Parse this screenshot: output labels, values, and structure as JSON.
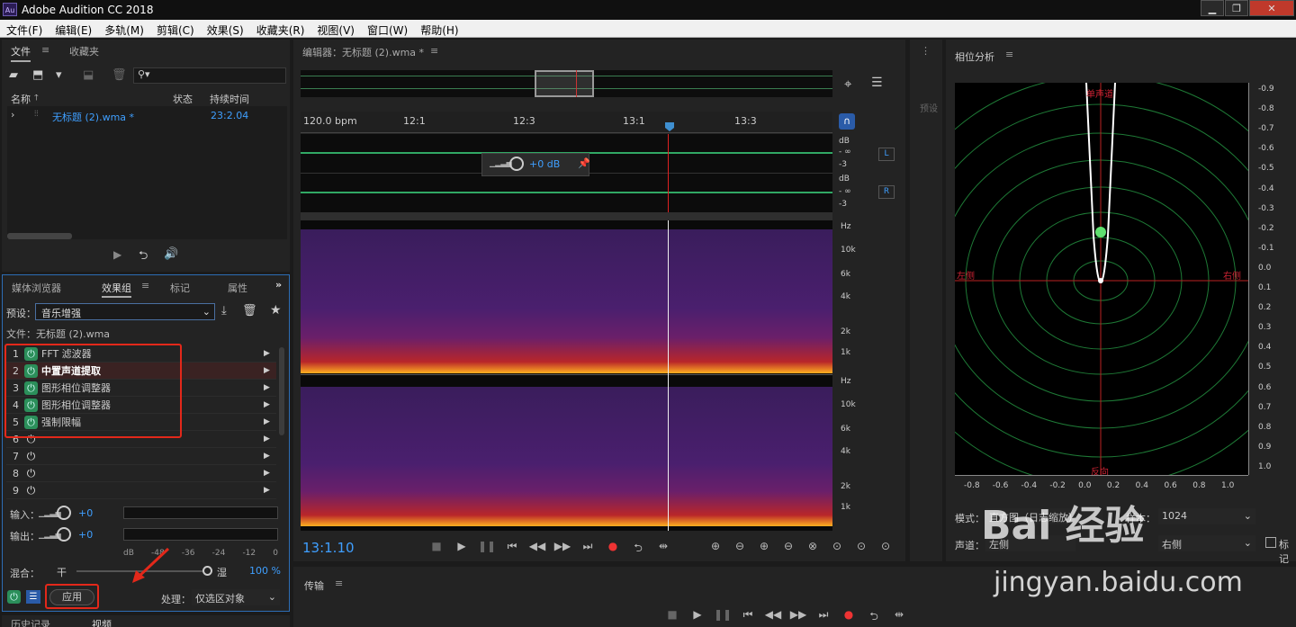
{
  "app": {
    "title": "Adobe Audition CC 2018",
    "icon_text": "Au"
  },
  "window_controls": [
    "minimize-icon",
    "maximize-icon",
    "close-icon"
  ],
  "menu": [
    "文件(F)",
    "编辑(E)",
    "多轨(M)",
    "剪辑(C)",
    "效果(S)",
    "收藏夹(R)",
    "视图(V)",
    "窗口(W)",
    "帮助(H)"
  ],
  "files_panel": {
    "tabs": [
      "文件",
      "收藏夹"
    ],
    "columns": [
      "名称",
      "状态",
      "持续时间"
    ],
    "file": {
      "name": "无标题 (2).wma *",
      "duration": "23:2.04"
    }
  },
  "effects_panel": {
    "tabs": [
      "媒体浏览器",
      "效果组",
      "标记",
      "属性"
    ],
    "preset_label": "预设：",
    "preset_value": "音乐增强",
    "file_label": "文件：无标题 (2).wma",
    "effects": [
      {
        "num": "1",
        "name": "FFT 滤波器",
        "on": true
      },
      {
        "num": "2",
        "name": "中置声道提取",
        "on": true
      },
      {
        "num": "3",
        "name": "图形相位调整器",
        "on": true
      },
      {
        "num": "4",
        "name": "图形相位调整器",
        "on": true
      },
      {
        "num": "5",
        "name": "强制限幅",
        "on": true
      },
      {
        "num": "6",
        "name": "",
        "on": false
      },
      {
        "num": "7",
        "name": "",
        "on": false
      },
      {
        "num": "8",
        "name": "",
        "on": false
      },
      {
        "num": "9",
        "name": "",
        "on": false
      }
    ],
    "input_label": "输入：",
    "input_value": "+0",
    "output_label": "输出：",
    "output_value": "+0",
    "meter_scale": [
      "dB",
      "-48",
      "-36",
      "-24",
      "-12",
      "0"
    ],
    "mix_label": "混合：",
    "dry_label": "干",
    "wet_label": "湿",
    "mix_value": "100 %",
    "apply_label": "应用",
    "process_label": "处理：",
    "process_value": "仅选区对象"
  },
  "bottom_left_tabs": [
    "历史记录",
    "视频"
  ],
  "editor": {
    "title": "编辑器：无标题 (2).wma *",
    "ruler": [
      "120.0 bpm",
      "12:1",
      "12:3",
      "13:1",
      "13:3"
    ],
    "hud_gain": "+0 dB",
    "db_scale": [
      "dB",
      "- ∞",
      "-3"
    ],
    "channels": [
      "L",
      "R"
    ],
    "freq_scale": [
      "Hz",
      "10k",
      "6k",
      "4k",
      "2k",
      "1k"
    ],
    "time": "13:1.10"
  },
  "transport_panel": {
    "title": "传输"
  },
  "phase_panel": {
    "title": "相位分析",
    "labels": {
      "top": "单声道",
      "left": "左侧",
      "right": "右侧",
      "bottom": "反向"
    },
    "y_scale": [
      "0.9",
      "0.8",
      "0.7",
      "0.6",
      "0.5",
      "0.4",
      "0.3",
      "0.2",
      "0.1",
      "0.0",
      "0.1",
      "0.2",
      "0.3",
      "0.4",
      "0.5",
      "0.6",
      "0.7",
      "0.8",
      "0.9",
      "1.0"
    ],
    "y_neg": [
      true,
      true,
      true,
      true,
      true,
      true,
      true,
      true,
      true,
      false,
      false,
      false,
      false,
      false,
      false,
      false,
      false,
      false,
      false,
      false
    ],
    "x_scale": [
      "-0.8",
      "-0.6",
      "-0.4",
      "-0.2",
      "0.0",
      "0.2",
      "0.4",
      "0.6",
      "0.8",
      "1.0"
    ],
    "mode_label": "模式：",
    "mode_value": "直方图（日志缩放）",
    "sample_label": "样本：",
    "sample_value": "1024",
    "channel_label": "声道：",
    "channel_value": "左侧",
    "channel2_value": "右侧",
    "extra_label": "标记"
  },
  "preset_side": "预设",
  "watermark": {
    "line1": "Bai 经验",
    "line2": "jingyan.baidu.com"
  }
}
